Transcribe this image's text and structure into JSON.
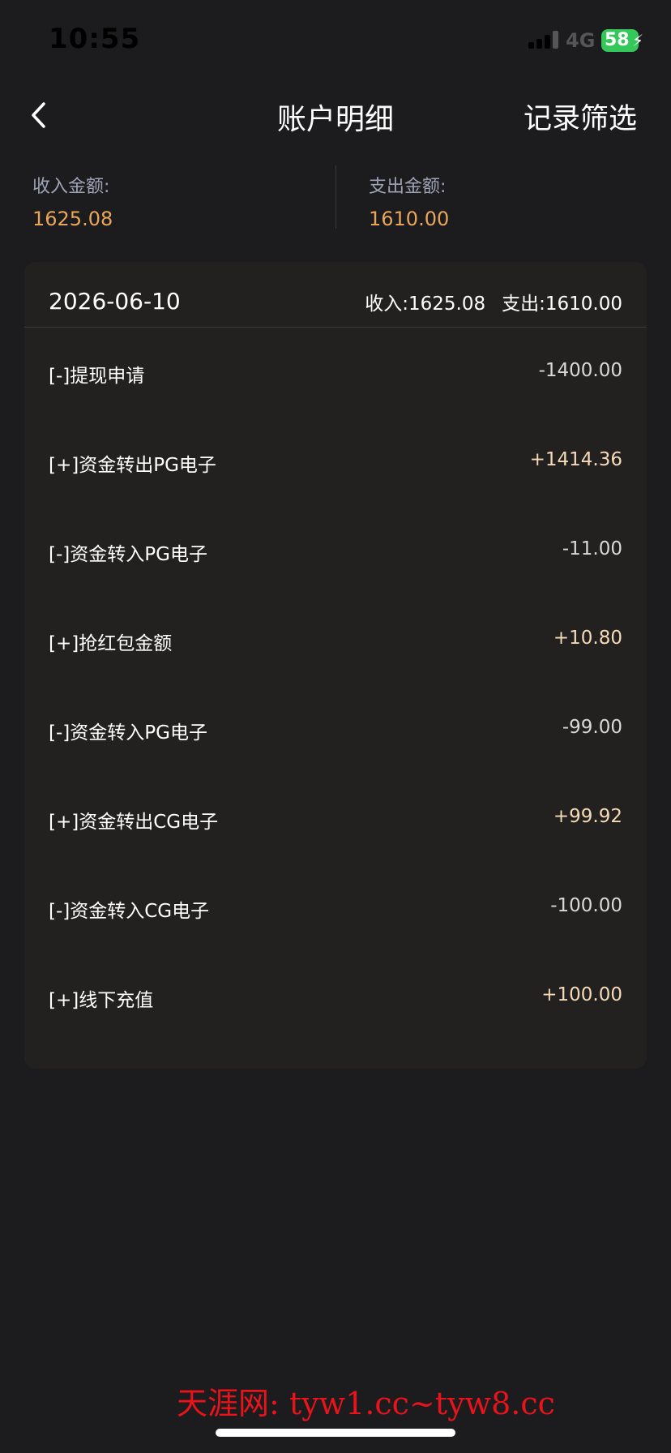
{
  "status_bar": {
    "time": "10:55",
    "network": "4G",
    "battery": "58"
  },
  "header": {
    "title": "账户明细",
    "filter_label": "记录筛选"
  },
  "summary": {
    "income_label": "收入金额:",
    "income_value": "1625.08",
    "expense_label": "支出金额:",
    "expense_value": "1610.00"
  },
  "card": {
    "date": "2026-06-10",
    "income_total": "收入:1625.08",
    "expense_total": "支出:1610.00",
    "rows": [
      {
        "label": "[-]提现申请",
        "amount": "-1400.00"
      },
      {
        "label": "[+]资金转出PG电子",
        "amount": "+1414.36"
      },
      {
        "label": "[-]资金转入PG电子",
        "amount": "-11.00"
      },
      {
        "label": "[+]抢红包金额",
        "amount": "+10.80"
      },
      {
        "label": "[-]资金转入PG电子",
        "amount": "-99.00"
      },
      {
        "label": "[+]资金转出CG电子",
        "amount": "+99.92"
      },
      {
        "label": "[-]资金转入CG电子",
        "amount": "-100.00"
      },
      {
        "label": "[+]线下充值",
        "amount": "+100.00"
      }
    ]
  },
  "watermark": "天涯网: tyw1.cc~tyw8.cc",
  "colors": {
    "background": "#1c1c1e",
    "card": "#232120",
    "summary_value": "#e9a658",
    "positive_amount": "#f4dab7",
    "negative_amount": "#d8d8d8",
    "watermark": "#e8131b"
  }
}
